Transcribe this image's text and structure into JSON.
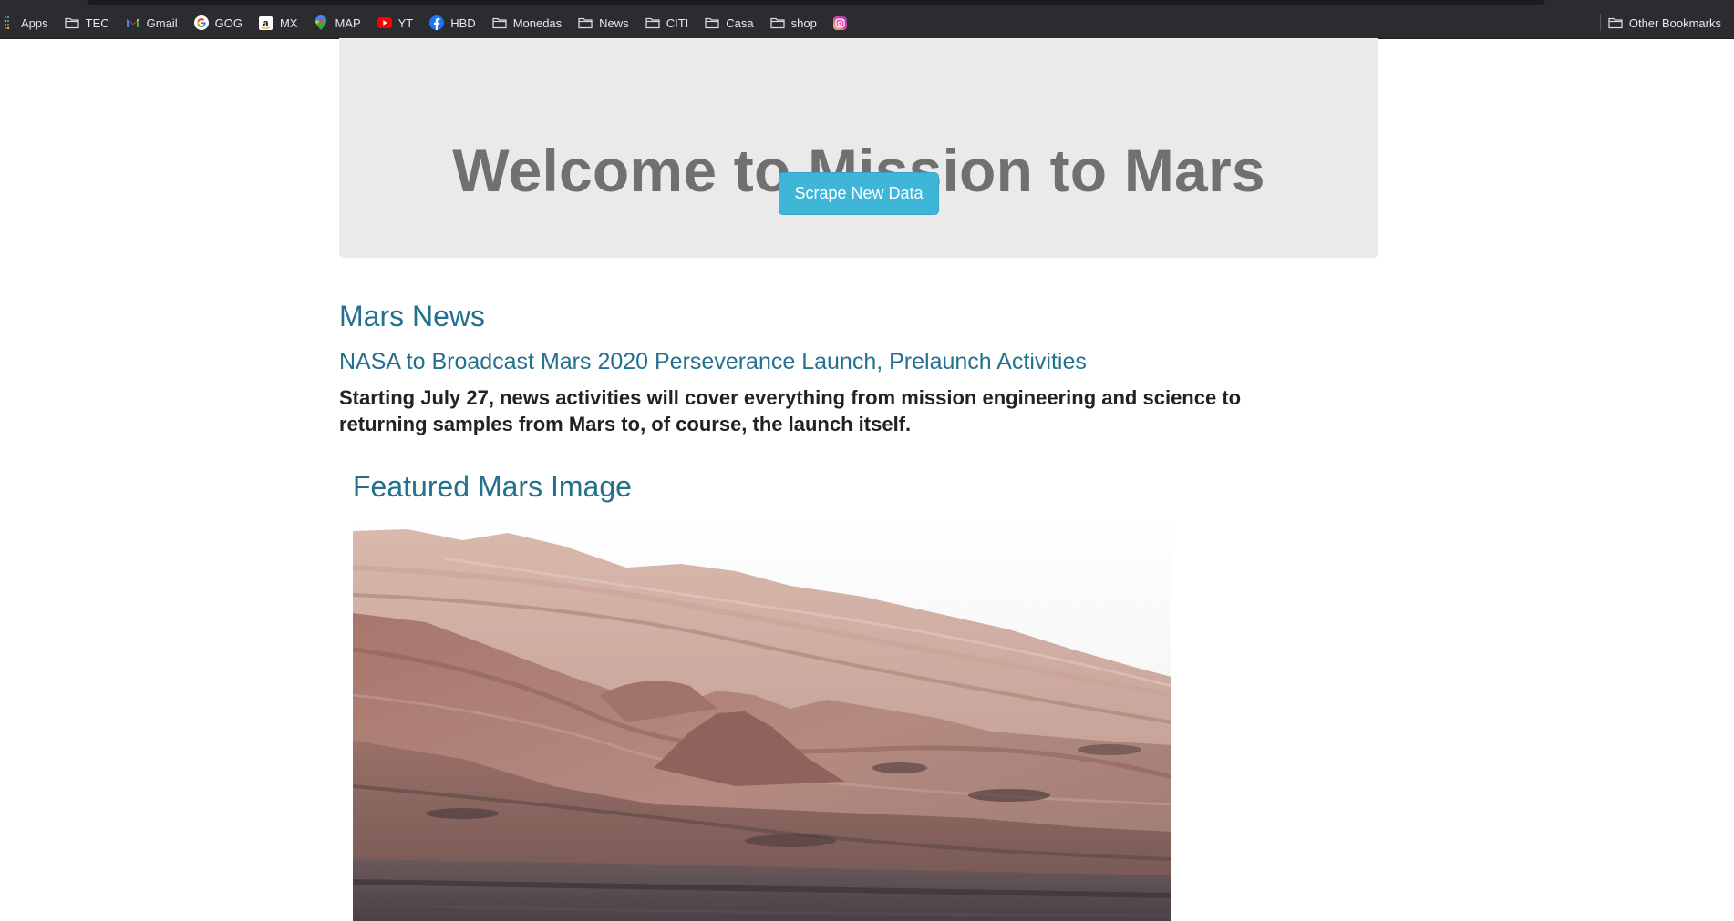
{
  "bookmarks": {
    "items": [
      {
        "label": "Apps",
        "icon": "apps-grid-icon"
      },
      {
        "label": "TEC",
        "icon": "folder-icon"
      },
      {
        "label": "Gmail",
        "icon": "gmail-icon"
      },
      {
        "label": "GOG",
        "icon": "google-icon"
      },
      {
        "label": "MX",
        "icon": "amazon-icon"
      },
      {
        "label": "MAP",
        "icon": "maps-pin-icon"
      },
      {
        "label": "YT",
        "icon": "youtube-icon"
      },
      {
        "label": "HBD",
        "icon": "facebook-icon"
      },
      {
        "label": "Monedas",
        "icon": "folder-icon"
      },
      {
        "label": "News",
        "icon": "folder-icon"
      },
      {
        "label": "CITI",
        "icon": "folder-icon"
      },
      {
        "label": "Casa",
        "icon": "folder-icon"
      },
      {
        "label": "shop",
        "icon": "folder-icon"
      },
      {
        "label": "",
        "icon": "instagram-icon"
      }
    ],
    "other_label": "Other Bookmarks"
  },
  "jumbotron": {
    "title": "Welcome to Mission to Mars",
    "button_label": "Scrape New Data"
  },
  "news": {
    "section_title": "Mars News",
    "headline": "NASA to Broadcast Mars 2020 Perseverance Launch, Prelaunch Activities",
    "teaser": "Starting July 27, news activities will cover everything from mission engineering and science to returning samples from Mars to, of course, the launch itself."
  },
  "featured": {
    "section_title": "Featured Mars Image"
  },
  "colors": {
    "bookmarks_bg": "#2b2c30",
    "jumbotron_bg": "#eaeaea",
    "button_bg": "#3fb5d8",
    "heading": "#24718f",
    "title_gray": "#707070"
  }
}
